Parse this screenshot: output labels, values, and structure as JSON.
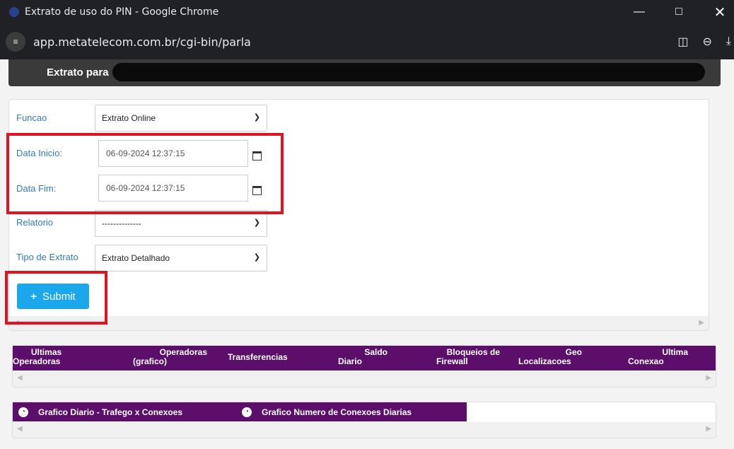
{
  "window": {
    "title": "Extrato de uso do PIN - Google Chrome",
    "url": "app.metatelecom.com.br/cgi-bin/parla"
  },
  "header": {
    "label": "Extrato para"
  },
  "form": {
    "funcao": {
      "label": "Funcao",
      "value": "Extrato Online"
    },
    "data_inicio": {
      "label": "Data Inicio:",
      "value": "06-09-2024 12:37:15"
    },
    "data_fim": {
      "label": "Data Fim:",
      "value": "06-09-2024 12:37:15"
    },
    "relatorio": {
      "label": "Relatorio",
      "value": "--------------"
    },
    "tipo_extrato": {
      "label": "Tipo de Extrato",
      "value": "Extrato Detalhado"
    },
    "submit_label": "Submit"
  },
  "tabs": [
    {
      "line1": "Ultimas",
      "line2": "Operadoras"
    },
    {
      "line1": "Operadoras",
      "line2": "(grafico)"
    },
    {
      "line1": "Transferencias",
      "line2": ""
    },
    {
      "line1": "Saldo",
      "line2": "Diario"
    },
    {
      "line1": "Bloqueios de",
      "line2": "Firewall"
    },
    {
      "line1": "Geo",
      "line2": "Localizacoes"
    },
    {
      "line1": "Ultima",
      "line2": "Conexao"
    }
  ],
  "graph_tabs": [
    {
      "label": "Grafico Diario - Trafego x Conexoes"
    },
    {
      "label": "Grafico Numero de Conexoes Diarias"
    }
  ],
  "colors": {
    "tab_bg": "#5c0f6a",
    "submit_bg": "#1aa7ec",
    "highlight": "#e0141e"
  }
}
